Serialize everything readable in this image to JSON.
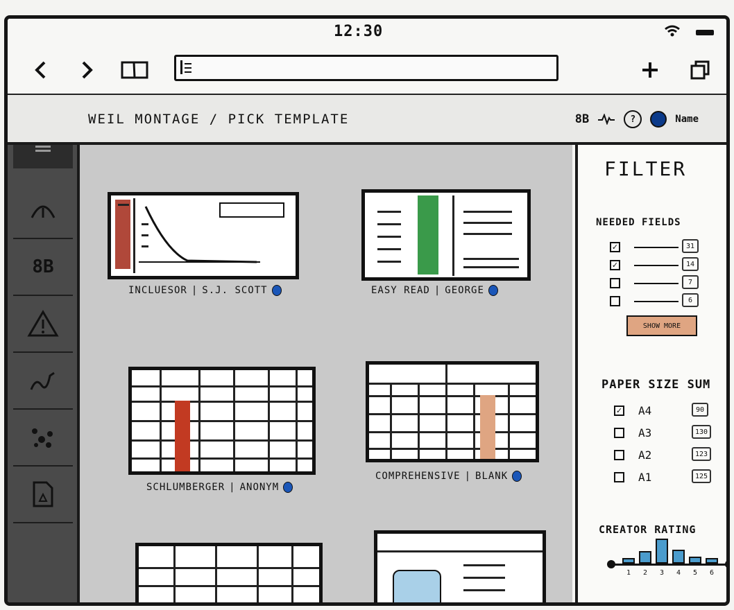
{
  "status": {
    "time": "12:30"
  },
  "header": {
    "breadcrumb": "WEIL MONTAGE / PICK TEMPLATE",
    "logo_text": "8B",
    "help": "?",
    "user_name": "Name"
  },
  "templates": [
    {
      "name": "INCLUESOR",
      "author": "S.J. SCOTT",
      "accent": "#b0483a"
    },
    {
      "name": "EASY READ",
      "author": "GEORGE",
      "accent": "#3a9a4a"
    },
    {
      "name": "SCHLUMBERGER",
      "author": "ANONYM",
      "accent": "#c23a22"
    },
    {
      "name": "COMPREHENSIVE",
      "author": "BLANK",
      "accent": "#dfa582"
    }
  ],
  "filter": {
    "title": "FILTER",
    "needed_fields": {
      "heading": "NEEDED FIELDS",
      "items": [
        {
          "checked": true,
          "count": "31"
        },
        {
          "checked": true,
          "count": "14"
        },
        {
          "checked": false,
          "count": "7"
        },
        {
          "checked": false,
          "count": "6"
        }
      ],
      "show_more": "SHOW MORE"
    },
    "paper_size": {
      "heading": "PAPER SIZE SUM",
      "items": [
        {
          "label": "A4",
          "checked": true,
          "count": "90"
        },
        {
          "label": "A3",
          "checked": false,
          "count": "130"
        },
        {
          "label": "A2",
          "checked": false,
          "count": "123"
        },
        {
          "label": "A1",
          "checked": false,
          "count": "125"
        }
      ]
    },
    "creator_rating": {
      "heading": "CREATOR RATING",
      "labels": [
        "1",
        "2",
        "3",
        "4",
        "5",
        "6"
      ],
      "histogram": [
        0.2,
        0.45,
        0.9,
        0.5,
        0.25,
        0.2
      ]
    }
  },
  "colors": {
    "sidebar": "#4a4a4a",
    "content_bg": "#c9c9c9",
    "accent_blue": "#1a56b8",
    "show_more": "#dfa582"
  }
}
